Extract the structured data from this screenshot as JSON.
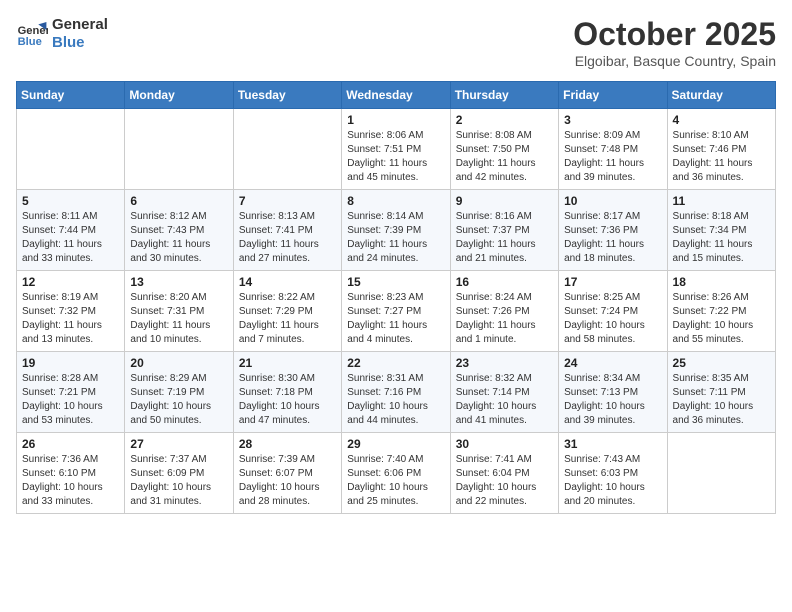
{
  "header": {
    "logo_line1": "General",
    "logo_line2": "Blue",
    "month": "October 2025",
    "location": "Elgoibar, Basque Country, Spain"
  },
  "weekdays": [
    "Sunday",
    "Monday",
    "Tuesday",
    "Wednesday",
    "Thursday",
    "Friday",
    "Saturday"
  ],
  "weeks": [
    [
      {
        "day": "",
        "info": ""
      },
      {
        "day": "",
        "info": ""
      },
      {
        "day": "",
        "info": ""
      },
      {
        "day": "1",
        "info": "Sunrise: 8:06 AM\nSunset: 7:51 PM\nDaylight: 11 hours\nand 45 minutes."
      },
      {
        "day": "2",
        "info": "Sunrise: 8:08 AM\nSunset: 7:50 PM\nDaylight: 11 hours\nand 42 minutes."
      },
      {
        "day": "3",
        "info": "Sunrise: 8:09 AM\nSunset: 7:48 PM\nDaylight: 11 hours\nand 39 minutes."
      },
      {
        "day": "4",
        "info": "Sunrise: 8:10 AM\nSunset: 7:46 PM\nDaylight: 11 hours\nand 36 minutes."
      }
    ],
    [
      {
        "day": "5",
        "info": "Sunrise: 8:11 AM\nSunset: 7:44 PM\nDaylight: 11 hours\nand 33 minutes."
      },
      {
        "day": "6",
        "info": "Sunrise: 8:12 AM\nSunset: 7:43 PM\nDaylight: 11 hours\nand 30 minutes."
      },
      {
        "day": "7",
        "info": "Sunrise: 8:13 AM\nSunset: 7:41 PM\nDaylight: 11 hours\nand 27 minutes."
      },
      {
        "day": "8",
        "info": "Sunrise: 8:14 AM\nSunset: 7:39 PM\nDaylight: 11 hours\nand 24 minutes."
      },
      {
        "day": "9",
        "info": "Sunrise: 8:16 AM\nSunset: 7:37 PM\nDaylight: 11 hours\nand 21 minutes."
      },
      {
        "day": "10",
        "info": "Sunrise: 8:17 AM\nSunset: 7:36 PM\nDaylight: 11 hours\nand 18 minutes."
      },
      {
        "day": "11",
        "info": "Sunrise: 8:18 AM\nSunset: 7:34 PM\nDaylight: 11 hours\nand 15 minutes."
      }
    ],
    [
      {
        "day": "12",
        "info": "Sunrise: 8:19 AM\nSunset: 7:32 PM\nDaylight: 11 hours\nand 13 minutes."
      },
      {
        "day": "13",
        "info": "Sunrise: 8:20 AM\nSunset: 7:31 PM\nDaylight: 11 hours\nand 10 minutes."
      },
      {
        "day": "14",
        "info": "Sunrise: 8:22 AM\nSunset: 7:29 PM\nDaylight: 11 hours\nand 7 minutes."
      },
      {
        "day": "15",
        "info": "Sunrise: 8:23 AM\nSunset: 7:27 PM\nDaylight: 11 hours\nand 4 minutes."
      },
      {
        "day": "16",
        "info": "Sunrise: 8:24 AM\nSunset: 7:26 PM\nDaylight: 11 hours\nand 1 minute."
      },
      {
        "day": "17",
        "info": "Sunrise: 8:25 AM\nSunset: 7:24 PM\nDaylight: 10 hours\nand 58 minutes."
      },
      {
        "day": "18",
        "info": "Sunrise: 8:26 AM\nSunset: 7:22 PM\nDaylight: 10 hours\nand 55 minutes."
      }
    ],
    [
      {
        "day": "19",
        "info": "Sunrise: 8:28 AM\nSunset: 7:21 PM\nDaylight: 10 hours\nand 53 minutes."
      },
      {
        "day": "20",
        "info": "Sunrise: 8:29 AM\nSunset: 7:19 PM\nDaylight: 10 hours\nand 50 minutes."
      },
      {
        "day": "21",
        "info": "Sunrise: 8:30 AM\nSunset: 7:18 PM\nDaylight: 10 hours\nand 47 minutes."
      },
      {
        "day": "22",
        "info": "Sunrise: 8:31 AM\nSunset: 7:16 PM\nDaylight: 10 hours\nand 44 minutes."
      },
      {
        "day": "23",
        "info": "Sunrise: 8:32 AM\nSunset: 7:14 PM\nDaylight: 10 hours\nand 41 minutes."
      },
      {
        "day": "24",
        "info": "Sunrise: 8:34 AM\nSunset: 7:13 PM\nDaylight: 10 hours\nand 39 minutes."
      },
      {
        "day": "25",
        "info": "Sunrise: 8:35 AM\nSunset: 7:11 PM\nDaylight: 10 hours\nand 36 minutes."
      }
    ],
    [
      {
        "day": "26",
        "info": "Sunrise: 7:36 AM\nSunset: 6:10 PM\nDaylight: 10 hours\nand 33 minutes."
      },
      {
        "day": "27",
        "info": "Sunrise: 7:37 AM\nSunset: 6:09 PM\nDaylight: 10 hours\nand 31 minutes."
      },
      {
        "day": "28",
        "info": "Sunrise: 7:39 AM\nSunset: 6:07 PM\nDaylight: 10 hours\nand 28 minutes."
      },
      {
        "day": "29",
        "info": "Sunrise: 7:40 AM\nSunset: 6:06 PM\nDaylight: 10 hours\nand 25 minutes."
      },
      {
        "day": "30",
        "info": "Sunrise: 7:41 AM\nSunset: 6:04 PM\nDaylight: 10 hours\nand 22 minutes."
      },
      {
        "day": "31",
        "info": "Sunrise: 7:43 AM\nSunset: 6:03 PM\nDaylight: 10 hours\nand 20 minutes."
      },
      {
        "day": "",
        "info": ""
      }
    ]
  ]
}
